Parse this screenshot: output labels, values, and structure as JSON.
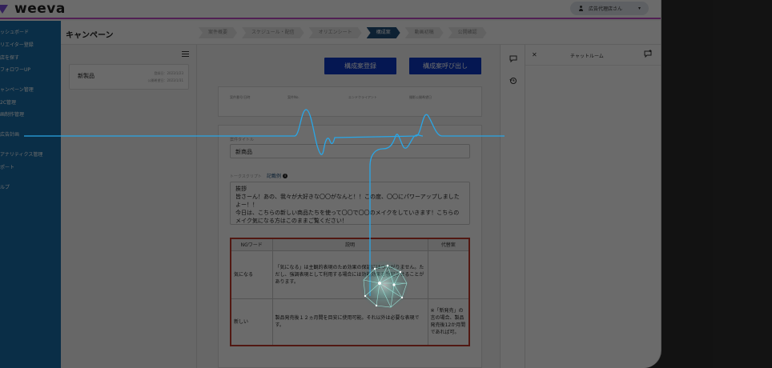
{
  "brand": {
    "logo_text": "weeva"
  },
  "topbar": {
    "user_name": "広告代理店さん",
    "user_icon": "person-icon",
    "caret": "▾"
  },
  "sidebar": {
    "items": [
      {
        "label": "ッシュボード"
      },
      {
        "label": "リエイター登録"
      },
      {
        "label": "店を探す"
      },
      {
        "label": "フォロワーUP"
      },
      {
        "label": "ャンペーン管理"
      },
      {
        "label": "2C管理"
      },
      {
        "label": "画制作管理"
      },
      {
        "label": "広告計画"
      },
      {
        "label": "アナリティクス管理"
      },
      {
        "label": "ポート"
      },
      {
        "label": "ルプ"
      }
    ]
  },
  "header": {
    "title": "キャンペーン",
    "steps": [
      {
        "label": "案件概要"
      },
      {
        "label": "スケジュール・配信"
      },
      {
        "label": "オリエンシート"
      },
      {
        "label": "構成案"
      },
      {
        "label": "動画初稿"
      },
      {
        "label": "公開確認"
      }
    ],
    "active_step": "構成案"
  },
  "list": {
    "menu_icon": "hamburger-icon",
    "cards": [
      {
        "title": "新製品",
        "meta1": "登録日：2023/1/23",
        "meta2": "公開希望日：2023/1/31"
      }
    ]
  },
  "main": {
    "register_button": "構成案登録",
    "recall_button": "構成案呼び出し",
    "info_labels": [
      "案件番号/日時",
      "案件No.",
      "エンドクライアント",
      "撮影公開希望日"
    ],
    "title_label": "案件タイトル",
    "title_value": "新商品",
    "talk_label": "トークスクリプト",
    "example_link": "記載例",
    "script_lines": [
      "挨拶",
      "皆さーん！あの、我々が大好きな〇〇がなんと！！この度、〇〇にパワーアップしましたよー！！",
      "今日は、こちらの新しい商品たちを使って〇〇で〇〇のメイクをしていきます！こちらのメイク気になる方はこのままご覧ください！"
    ],
    "ng_table": {
      "headers": [
        "NGワード",
        "説明",
        "代替案"
      ],
      "rows": [
        {
          "word": "気になる",
          "desc": "「気になる」は主観的表現のため効果の保証にはつながりません。ただし、強調表現として利用する場合には効能効果を想起させることがあります。",
          "alt": ""
        },
        {
          "word": "新しい",
          "desc": "製品発売後１２ヵ月間を目安に使用可能。それ以外は必要な表現です。",
          "alt": "※「新発売」の言の場合、製品発売後12か月間であれば可。"
        }
      ]
    }
  },
  "rail": {
    "chat_icon": "chat-bubble-icon",
    "history_icon": "history-icon"
  },
  "chat": {
    "close_icon": "close-icon",
    "title": "チャットルーム",
    "new_icon": "new-chat-icon"
  },
  "colors": {
    "sidebar": "#1a6fa9",
    "accent": "#0c37c4",
    "active_step": "#1f4f7b",
    "table_border": "#c0392b",
    "waveform": "#2aa6e6"
  }
}
